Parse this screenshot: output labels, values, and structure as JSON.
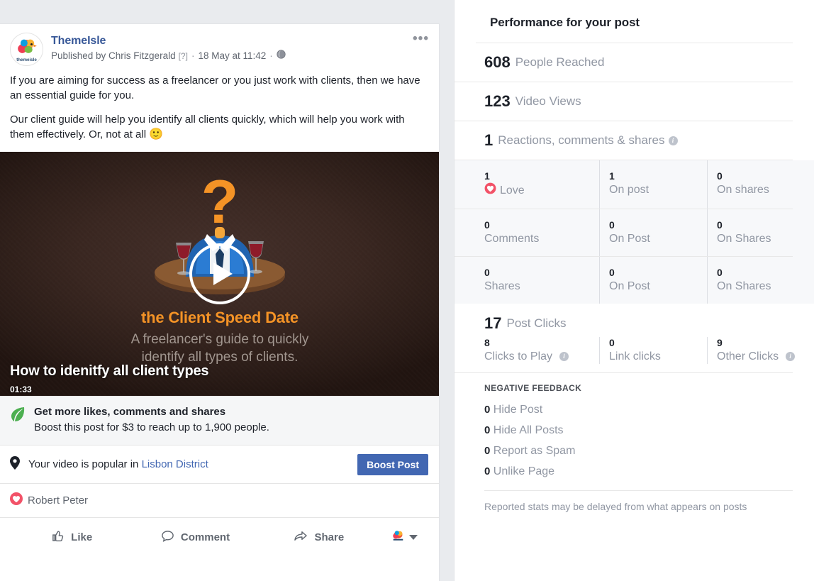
{
  "post": {
    "page_name": "ThemeIsle",
    "published_by": "Published by Chris Fitzgerald",
    "question_mark": "[?]",
    "timestamp": "18 May at 11:42",
    "separator": "·",
    "menu_icon": "•••",
    "body_paragraph_1": "If you are aiming for success as a freelancer or you just work with clients, then we have an essential guide for you.",
    "body_paragraph_2": "Our client guide will help you identify all clients quickly, which will help you work with them effectively. Or, not at all ",
    "body_emoji": "🙂"
  },
  "video": {
    "title": "the Client Speed Date",
    "subtitle_line1": "A freelancer's guide to quickly",
    "subtitle_line2": "identify all types of clients.",
    "overlay_title": "How to idenitfy all client types",
    "duration": "01:33"
  },
  "boost": {
    "promo_title": "Get more likes, comments and shares",
    "promo_subtitle": "Boost this post for $3 to reach up to 1,900 people.",
    "popular_prefix": "Your video is popular in ",
    "popular_location": "Lisbon District",
    "button_label": "Boost Post"
  },
  "reactor": {
    "name": "Robert Peter"
  },
  "actions": {
    "like": "Like",
    "comment": "Comment",
    "share": "Share"
  },
  "insights": {
    "title": "Performance for your post",
    "summary_rows": [
      {
        "value": "608",
        "label": "People Reached",
        "info": false
      },
      {
        "value": "123",
        "label": "Video Views",
        "info": false
      },
      {
        "value": "1",
        "label": "Reactions, comments & shares",
        "info": true
      }
    ],
    "reaction_grid": [
      {
        "c1_num": "1",
        "c1_label": "Love",
        "c1_icon": "love-heart-icon",
        "c2_num": "1",
        "c2_label": "On post",
        "c3_num": "0",
        "c3_label": "On shares"
      },
      {
        "c1_num": "0",
        "c1_label": "Comments",
        "c1_icon": "",
        "c2_num": "0",
        "c2_label": "On Post",
        "c3_num": "0",
        "c3_label": "On Shares"
      },
      {
        "c1_num": "0",
        "c1_label": "Shares",
        "c1_icon": "",
        "c2_num": "0",
        "c2_label": "On Post",
        "c3_num": "0",
        "c3_label": "On Shares"
      }
    ],
    "post_clicks": {
      "value": "17",
      "label": "Post Clicks",
      "cells": [
        {
          "num": "8",
          "label": "Clicks to Play",
          "info": true
        },
        {
          "num": "0",
          "label": "Link clicks",
          "info": false
        },
        {
          "num": "9",
          "label": "Other Clicks",
          "info": true
        }
      ]
    },
    "negative_feedback": {
      "heading": "NEGATIVE FEEDBACK",
      "items": [
        {
          "num": "0",
          "label": "Hide Post"
        },
        {
          "num": "0",
          "label": "Hide All Posts"
        },
        {
          "num": "0",
          "label": "Report as Spam"
        },
        {
          "num": "0",
          "label": "Unlike Page"
        }
      ]
    },
    "footnote": "Reported stats may be delayed from what appears on posts"
  },
  "colors": {
    "fb_blue": "#4267b2",
    "link_blue": "#385898",
    "love_red": "#f25268",
    "accent_orange": "#f49326",
    "page_bg": "#e9ebee",
    "muted": "#9197a3"
  }
}
